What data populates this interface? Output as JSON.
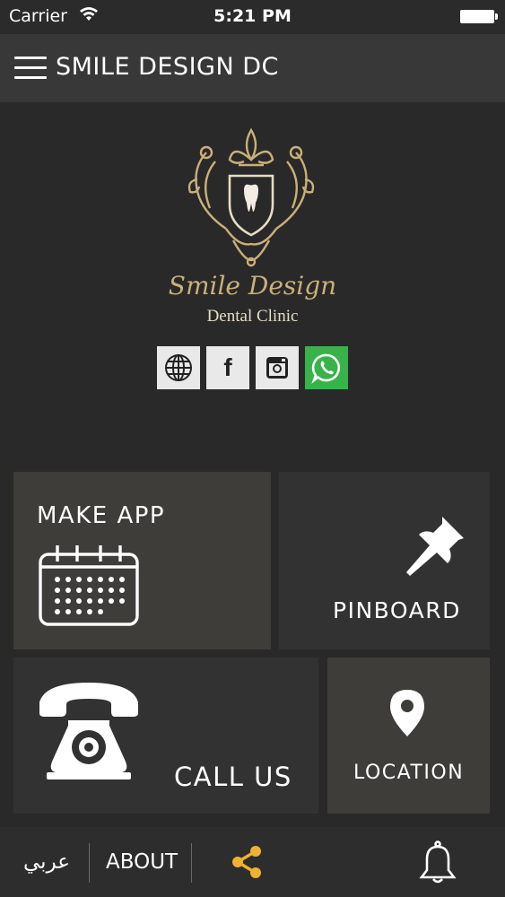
{
  "status_bar": {
    "carrier": "Carrier",
    "time": "5:21 PM"
  },
  "nav": {
    "title": "SMILE DESIGN DC",
    "menu_icon": "hamburger-menu-icon"
  },
  "logo": {
    "script_text": "Smile Design",
    "sub_text": "Dental Clinic"
  },
  "socials": [
    {
      "name": "website-globe-icon",
      "label": ""
    },
    {
      "name": "facebook-icon",
      "label": "f"
    },
    {
      "name": "instagram-icon",
      "label": ""
    },
    {
      "name": "whatsapp-icon",
      "label": ""
    }
  ],
  "tiles": {
    "make_app": "MAKE APP",
    "pinboard": "PINBOARD",
    "call_us": "CALL US",
    "location": "LOCATION"
  },
  "bottom_bar": {
    "arabic": "عربي",
    "about": "ABOUT"
  },
  "colors": {
    "accent_gold": "#c9b07a",
    "share_orange": "#f0b030",
    "whatsapp_green": "#37b34a"
  }
}
